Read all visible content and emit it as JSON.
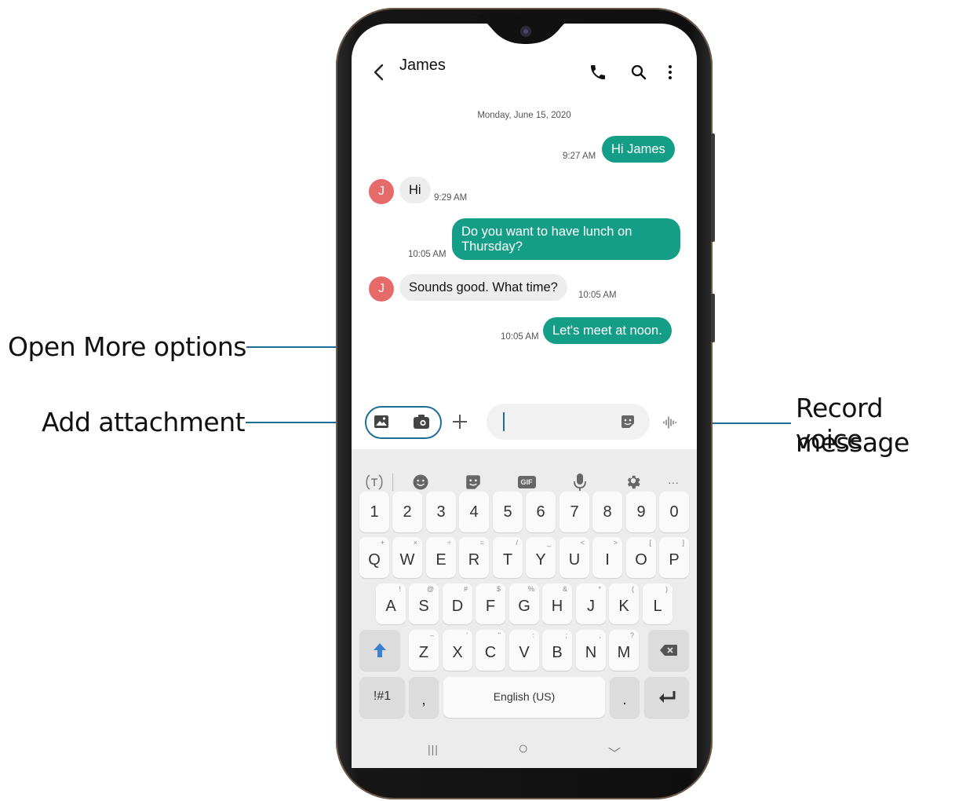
{
  "callouts": {
    "more_options": "Open More options",
    "attachment": "Add attachment",
    "voice_line1": "Record voice",
    "voice_line2": "message"
  },
  "conversation": {
    "contact_name": "James",
    "date": "Monday, June 15, 2020",
    "messages": [
      {
        "direction": "out",
        "text": "Hi James",
        "time": "9:27 AM"
      },
      {
        "direction": "in",
        "avatar": "J",
        "text": "Hi",
        "time": "9:29 AM"
      },
      {
        "direction": "out",
        "text_line1": "Do you want to have lunch on",
        "text_line2": "Thursday?",
        "time": "10:05 AM"
      },
      {
        "direction": "in",
        "avatar": "J",
        "text": "Sounds good. What time?",
        "time": "10:05 AM"
      },
      {
        "direction": "out",
        "text": "Let's meet at noon.",
        "time": "10:05 AM"
      }
    ]
  },
  "icons": {
    "back": "back-arrow-icon",
    "call": "phone-icon",
    "search": "search-icon",
    "more": "more-vert-icon",
    "gallery": "gallery-icon",
    "camera": "camera-icon",
    "plus": "plus-icon",
    "sticker": "sticker-icon",
    "voice": "voice-wave-icon"
  },
  "keyboard": {
    "toolbar": [
      "translate-icon",
      "emoji-icon",
      "sticker-icon",
      "gif-icon",
      "mic-icon",
      "settings-icon",
      "more-horiz-icon"
    ],
    "gif_label": "GIF",
    "more_label": "···",
    "number_row": [
      "1",
      "2",
      "3",
      "4",
      "5",
      "6",
      "7",
      "8",
      "9",
      "0"
    ],
    "row1": [
      {
        "k": "Q",
        "s": "+"
      },
      {
        "k": "W",
        "s": "×"
      },
      {
        "k": "E",
        "s": "÷"
      },
      {
        "k": "R",
        "s": "="
      },
      {
        "k": "T",
        "s": "/"
      },
      {
        "k": "Y",
        "s": "_"
      },
      {
        "k": "U",
        "s": "<"
      },
      {
        "k": "I",
        "s": ">"
      },
      {
        "k": "O",
        "s": "["
      },
      {
        "k": "P",
        "s": "]"
      }
    ],
    "row2": [
      {
        "k": "A",
        "s": "!"
      },
      {
        "k": "S",
        "s": "@"
      },
      {
        "k": "D",
        "s": "#"
      },
      {
        "k": "F",
        "s": "$"
      },
      {
        "k": "G",
        "s": "%"
      },
      {
        "k": "H",
        "s": "&"
      },
      {
        "k": "J",
        "s": "*"
      },
      {
        "k": "K",
        "s": "("
      },
      {
        "k": "L",
        "s": ")"
      }
    ],
    "row3": [
      {
        "k": "Z",
        "s": "–"
      },
      {
        "k": "X",
        "s": "'"
      },
      {
        "k": "C",
        "s": "\""
      },
      {
        "k": "V",
        "s": ":"
      },
      {
        "k": "B",
        "s": ";"
      },
      {
        "k": "N",
        "s": ","
      },
      {
        "k": "M",
        "s": "?"
      }
    ],
    "symbols_label": "!#1",
    "comma_label": ",",
    "space_label": "English (US)",
    "period_label": "."
  },
  "navbar": {
    "recents": "|||",
    "home": "○",
    "back": "﹀"
  },
  "colors": {
    "accent": "#1f6d96",
    "bubble_out": "#159e87",
    "avatar": "#e66a6a",
    "keyboard_bg": "#ececec"
  }
}
